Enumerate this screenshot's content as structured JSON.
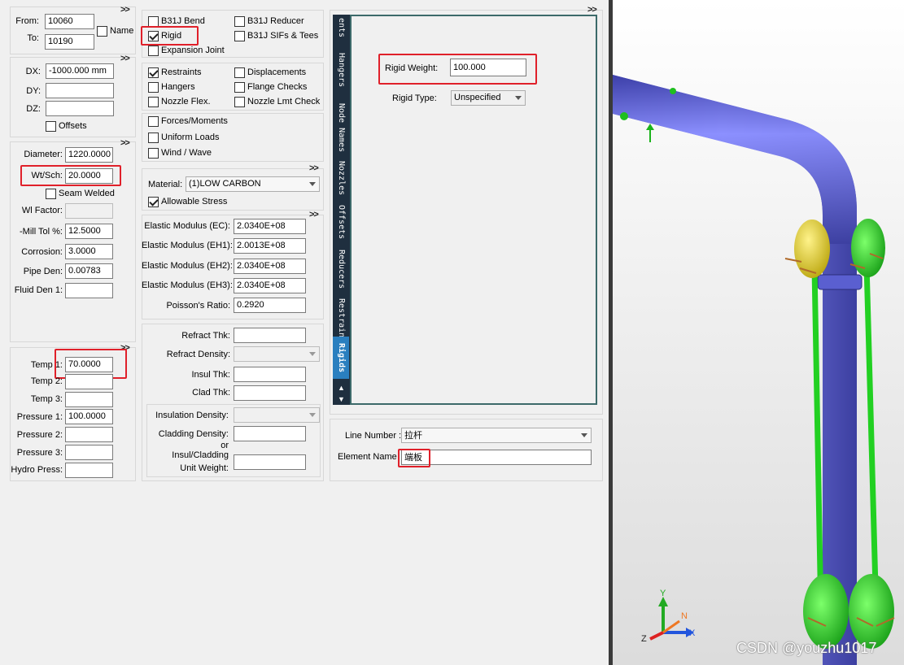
{
  "left": {
    "from_label": "From:",
    "from_value": "10060",
    "to_label": "To:",
    "to_value": "10190",
    "name_label": "Name",
    "dx_label": "DX:",
    "dx_value": "-1000.000 mm",
    "dy_label": "DY:",
    "dz_label": "DZ:",
    "offsets_label": "Offsets",
    "diameter_label": "Diameter:",
    "diameter_value": "1220.0000",
    "wtsch_label": "Wt/Sch:",
    "wtsch_value": "20.0000",
    "seam_welded_label": "Seam Welded",
    "wl_factor_label": "Wl Factor:",
    "mill_tol_label": "-Mill Tol %:",
    "mill_tol_value": "12.5000",
    "corrosion_label": "Corrosion:",
    "corrosion_value": "3.0000",
    "pipe_den_label": "Pipe Den:",
    "pipe_den_value": "0.00783",
    "fluid_den_label": "Fluid Den 1:",
    "temp1_label": "Temp 1:",
    "temp1_value": "70.0000",
    "temp2_label": "Temp 2:",
    "temp3_label": "Temp 3:",
    "pressure1_label": "Pressure 1:",
    "pressure1_value": "100.0000",
    "pressure2_label": "Pressure 2:",
    "pressure3_label": "Pressure 3:",
    "hydro_press_label": "Hydro Press:",
    "expand": ">>"
  },
  "middle": {
    "b31j_bend": "B31J Bend",
    "b31j_reducer": "B31J Reducer",
    "rigid": "Rigid",
    "b31j_sifs": "B31J SIFs & Tees",
    "expansion_joint": "Expansion Joint",
    "restraints": "Restraints",
    "displacements": "Displacements",
    "hangers": "Hangers",
    "flange_checks": "Flange Checks",
    "nozzle_flex": "Nozzle Flex.",
    "nozzle_lmt_check": "Nozzle Lmt Check",
    "forces_moments": "Forces/Moments",
    "uniform_loads": "Uniform Loads",
    "wind_wave": "Wind / Wave",
    "material_label": "Material:",
    "material_value": "(1)LOW CARBON",
    "allowable_stress": "Allowable Stress",
    "ec_label": "Elastic Modulus (EC):",
    "ec_value": "2.0340E+08",
    "eh1_label": "Elastic Modulus (EH1):",
    "eh1_value": "2.0013E+08",
    "eh2_label": "Elastic Modulus (EH2):",
    "eh2_value": "2.0340E+08",
    "eh3_label": "Elastic Modulus (EH3):",
    "eh3_value": "2.0340E+08",
    "poisson_label": "Poisson's Ratio:",
    "poisson_value": "0.2920",
    "refract_thk_label": "Refract Thk:",
    "refract_density_label": "Refract Density:",
    "insul_thk_label": "Insul Thk:",
    "clad_thk_label": "Clad Thk:",
    "insulation_density_label": "Insulation Density:",
    "cladding_density_label": "Cladding Density:",
    "or_label": "or",
    "insul_cladding_label": "Insul/Cladding",
    "unit_weight_label": "Unit Weight:",
    "expand": ">>"
  },
  "tabs": {
    "items": [
      "ents",
      "Hangers",
      "Node Names",
      "Nozzles",
      "Offsets",
      "Reducers",
      "Restraints",
      "Rigids"
    ],
    "active": "Rigids",
    "up_arrow": "▲",
    "down_arrow": "▼"
  },
  "rigid_panel": {
    "rigid_weight_label": "Rigid Weight:",
    "rigid_weight_value": "100.000",
    "rigid_type_label": "Rigid Type:",
    "rigid_type_value": "Unspecified",
    "expand": ">>"
  },
  "line_panel": {
    "line_number_label": "Line Number :",
    "line_number_value": "拉杆",
    "element_name_label": "Element Name",
    "element_name_value": "端板"
  },
  "viewport": {
    "axis_y": "Y",
    "axis_x": "X",
    "axis_z": "Z",
    "axis_n": "N",
    "watermark": "CSDN @youzhu1017",
    "colors": {
      "pipe": "#6b6fe6",
      "rod": "#22cc22",
      "yellow": "#e8d81c",
      "background_top": "#ffffff",
      "background_bottom": "#d6d6d6"
    }
  }
}
